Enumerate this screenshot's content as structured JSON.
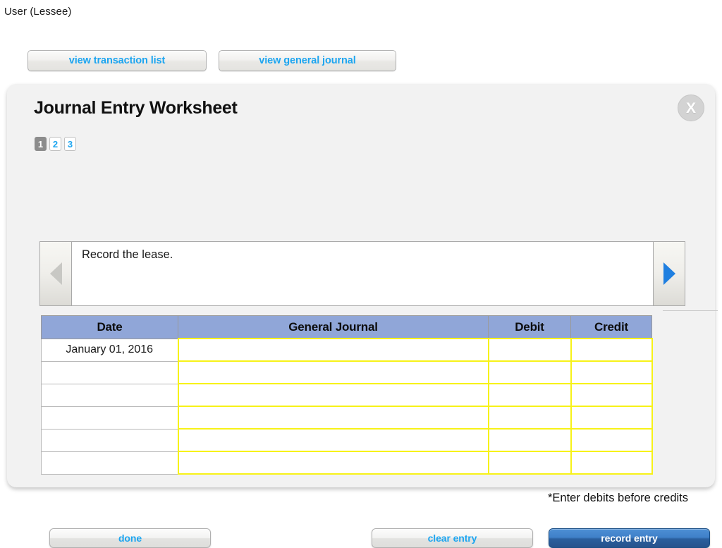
{
  "page": {
    "user_label": "User (Lessee)"
  },
  "toolbar": {
    "view_transaction_list": "view transaction list",
    "view_general_journal": "view general journal"
  },
  "worksheet": {
    "title": "Journal Entry Worksheet",
    "close_label": "X",
    "steps": [
      {
        "label": "1",
        "active": true
      },
      {
        "label": "2",
        "active": false
      },
      {
        "label": "3",
        "active": false
      }
    ],
    "navigator": {
      "instruction": "Record the lease.",
      "prev_enabled": false,
      "next_enabled": true
    },
    "table": {
      "headers": [
        "Date",
        "General Journal",
        "Debit",
        "Credit"
      ],
      "rows": [
        {
          "date": "January 01, 2016",
          "general_journal": "",
          "debit": "",
          "credit": ""
        },
        {
          "date": "",
          "general_journal": "",
          "debit": "",
          "credit": ""
        },
        {
          "date": "",
          "general_journal": "",
          "debit": "",
          "credit": ""
        },
        {
          "date": "",
          "general_journal": "",
          "debit": "",
          "credit": ""
        },
        {
          "date": "",
          "general_journal": "",
          "debit": "",
          "credit": ""
        },
        {
          "date": "",
          "general_journal": "",
          "debit": "",
          "credit": ""
        }
      ]
    },
    "footnote": "*Enter debits before credits",
    "actions": {
      "done": "done",
      "clear_entry": "clear entry",
      "record_entry": "record entry"
    }
  },
  "colors": {
    "accent_link": "#1ca5f0",
    "header_blue": "#90a6d8",
    "entry_border_yellow": "#f7f218",
    "record_button_blue": "#3f80c9",
    "panel_background": "#f2f2f2"
  }
}
